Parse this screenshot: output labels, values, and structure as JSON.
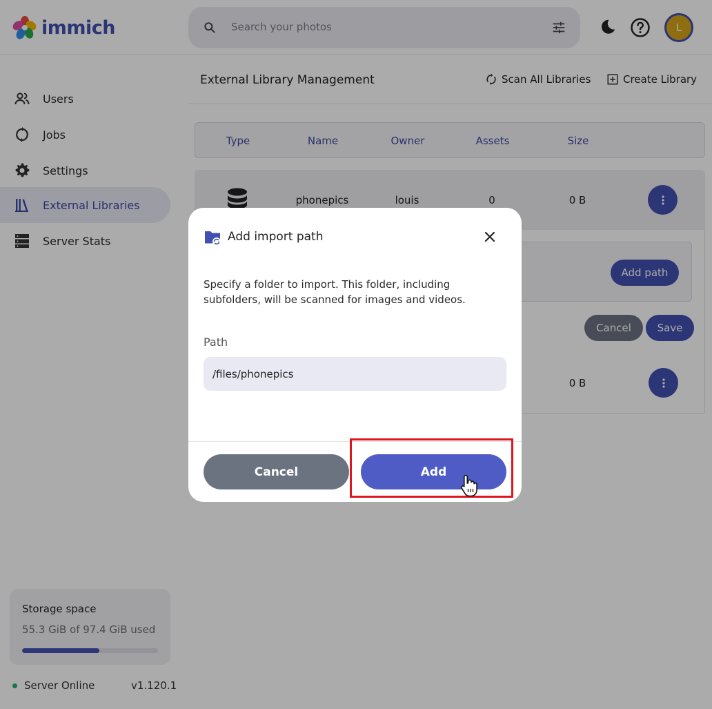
{
  "app": {
    "logo_text": "immich",
    "search_placeholder": "Search your photos",
    "avatar_initial": "L"
  },
  "icons": {
    "search": "search-icon",
    "filter": "sliders-icon",
    "theme": "moon-icon",
    "help": "help-circle-icon",
    "users": "users-icon",
    "jobs": "sync-icon",
    "settings": "gear-icon",
    "libraries": "library-icon",
    "stats": "server-icon",
    "database": "database-icon",
    "folder_sync": "folder-sync-icon",
    "close": "close-icon",
    "more": "dots-vertical-icon"
  },
  "sidebar": {
    "items": [
      {
        "label": "Users",
        "active": false
      },
      {
        "label": "Jobs",
        "active": false
      },
      {
        "label": "Settings",
        "active": false
      },
      {
        "label": "External Libraries",
        "active": true
      },
      {
        "label": "Server Stats",
        "active": false
      }
    ],
    "storage": {
      "title": "Storage space",
      "used_text": "55.3 GiB of 97.4 GiB used",
      "used_fraction": 0.568
    },
    "status": "Server Online",
    "version": "v1.120.1"
  },
  "main": {
    "title": "External Library Management",
    "scan_all_label": "Scan All Libraries",
    "create_label": "Create Library",
    "columns": [
      "Type",
      "Name",
      "Owner",
      "Assets",
      "Size"
    ],
    "rows": [
      {
        "name": "phonepics",
        "owner": "louis",
        "assets": "0",
        "size": "0 B"
      },
      {
        "size": "0 B"
      }
    ],
    "add_path_label": "Add path",
    "cancel_label": "Cancel",
    "save_label": "Save"
  },
  "modal": {
    "title": "Add import path",
    "description": "Specify a folder to import. This folder, including subfolders, will be scanned for images and videos.",
    "path_label": "Path",
    "path_value": "/files/phonepics",
    "cancel_label": "Cancel",
    "add_label": "Add"
  },
  "colors": {
    "accent": "#4250af",
    "add_button": "#4f5cc6",
    "cancel_button": "#6b7280",
    "highlight": "#e0161f",
    "online": "#22b06a",
    "avatar": "#d4a418"
  }
}
